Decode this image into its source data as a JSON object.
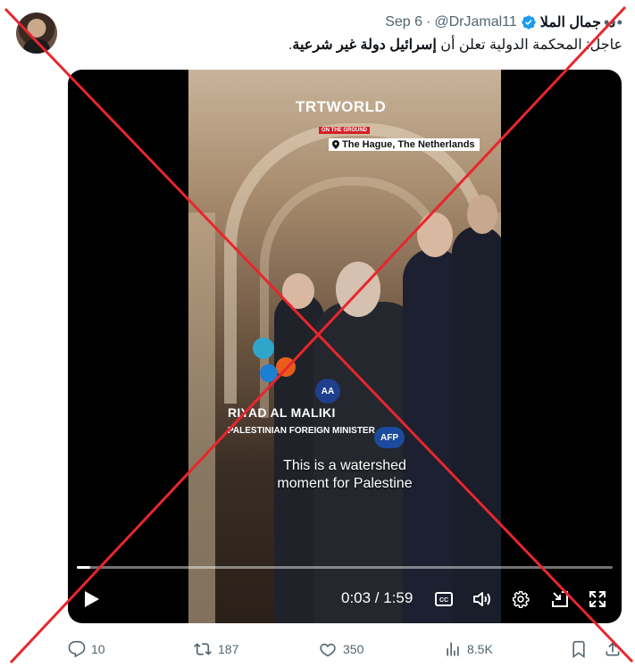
{
  "header": {
    "display_name": "د. جمال الملا",
    "handle": "@DrJamal11",
    "separator": "·",
    "date": "Sep 6",
    "more_label": "•••"
  },
  "tweet": {
    "text_prefix": "عاجل: المحكمة الدولية تعلن أن ",
    "text_bold": "إسرائيل دولة غير شرعية",
    "text_suffix": "."
  },
  "video": {
    "brand": "TRTWORLD",
    "segment_tag": "ON THE GROUND",
    "location": "The Hague, The Netherlands",
    "speaker_name": "RIYAD AL MALIKI",
    "speaker_title": "PALESTINIAN FOREIGN MINISTER",
    "caption_line1": "This is a watershed",
    "caption_line2": "moment for Palestine",
    "aa_logo": "AA",
    "afp_logo": "AFP",
    "current_time": "0:03",
    "duration": "1:59",
    "time_display": "0:03 / 1:59",
    "progress_fraction": 0.025
  },
  "actions": {
    "replies": "10",
    "retweets": "187",
    "likes": "350",
    "views": "8.5K"
  },
  "colors": {
    "overlay_x": "#e8262d",
    "verified": "#1d9bf0",
    "muted_text": "#536471"
  }
}
